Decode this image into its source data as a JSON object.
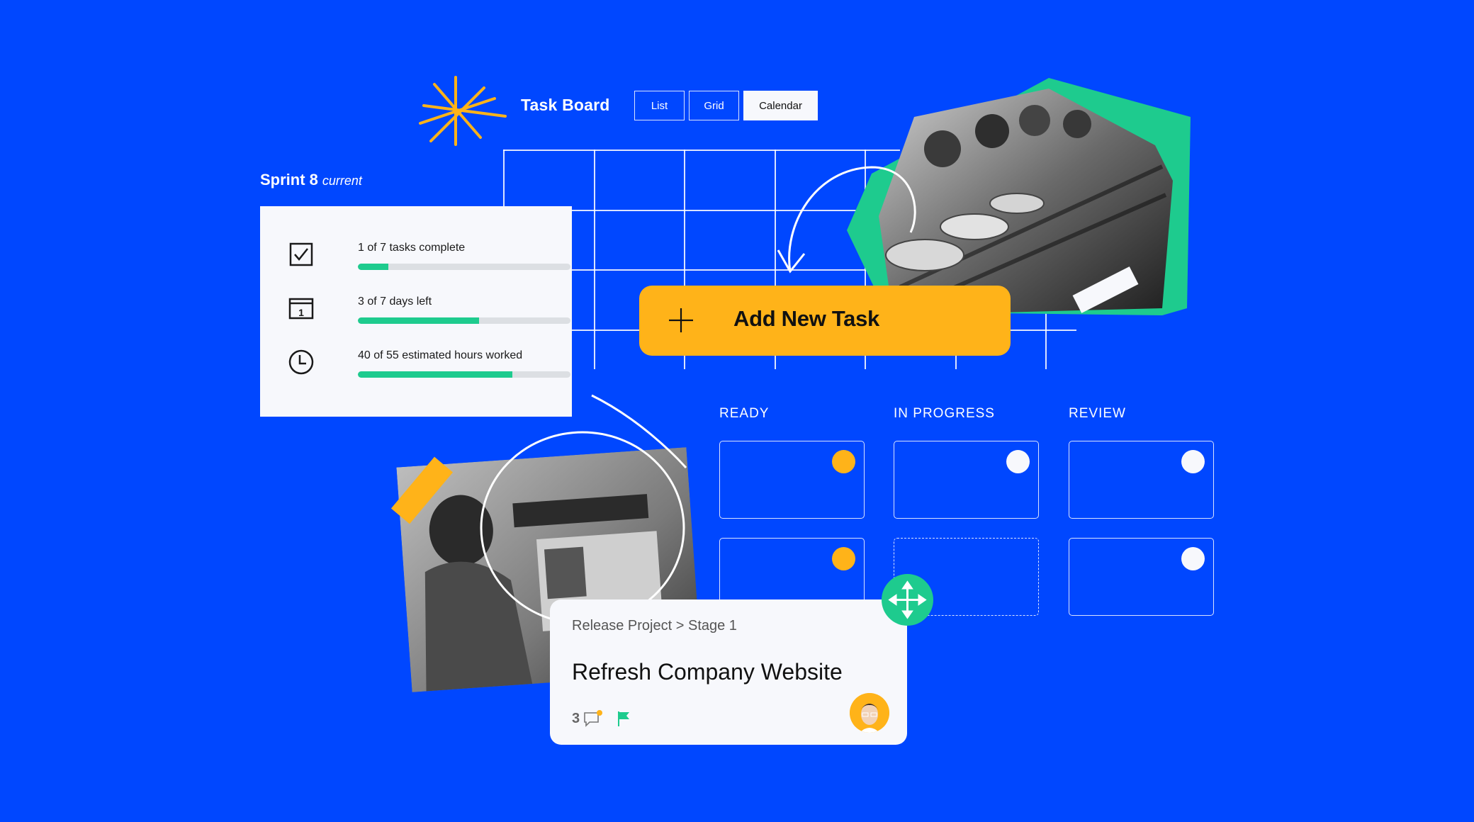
{
  "header": {
    "app_title": "Task Board",
    "logo_icon": "starburst-icon",
    "tabs": [
      {
        "label": "List",
        "active": false
      },
      {
        "label": "Grid",
        "active": false
      },
      {
        "label": "Calendar",
        "active": true
      }
    ]
  },
  "sprint": {
    "title": "Sprint 8",
    "status": "current",
    "metrics": [
      {
        "icon": "checkbox-icon",
        "label": "1 of 7 tasks complete",
        "progress": 0.143
      },
      {
        "icon": "calendar-icon",
        "label": "3 of 7 days left",
        "progress": 0.57,
        "calendar_number": "1"
      },
      {
        "icon": "clock-icon",
        "label": "40 of 55 estimated hours worked",
        "progress": 0.727
      }
    ]
  },
  "add_task": {
    "label": "Add New Task",
    "icon": "plus-icon"
  },
  "board": {
    "columns": [
      {
        "label": "READY",
        "cards": [
          {
            "dot": "yellow"
          },
          {
            "dot": "yellow"
          }
        ]
      },
      {
        "label": "IN PROGRESS",
        "cards": [
          {
            "dot": "white"
          },
          {
            "placeholder": true
          }
        ]
      },
      {
        "label": "REVIEW",
        "cards": [
          {
            "dot": "white"
          },
          {
            "dot": "white"
          }
        ]
      }
    ]
  },
  "task_card": {
    "breadcrumb": "Release Project > Stage 1",
    "title": "Refresh Company Website",
    "comment_count": "3",
    "has_unread_comments": true,
    "flag_icon": "flag-icon",
    "assignee_avatar": "avatar"
  },
  "colors": {
    "background": "#0047FF",
    "accent_yellow": "#FFB319",
    "accent_green": "#1ECB8E",
    "card_bg": "#F7F8FC",
    "track_gray": "#DCDFE3"
  }
}
